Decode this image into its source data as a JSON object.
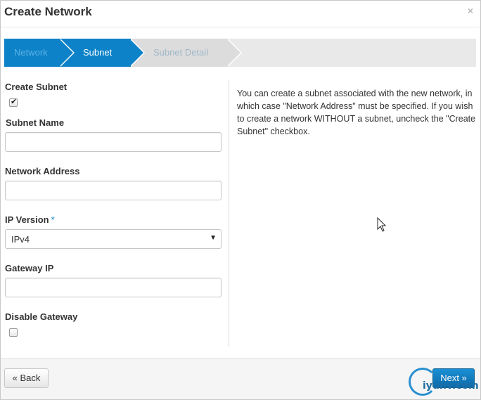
{
  "dialog": {
    "title": "Create Network",
    "close_icon": "close-icon",
    "close_glyph": "×"
  },
  "wizard": {
    "steps": [
      {
        "label": "Network",
        "state": "completed"
      },
      {
        "label": "Subnet",
        "state": "active"
      },
      {
        "label": "Subnet Detail",
        "state": "pending"
      }
    ],
    "active_color": "#0d82c8"
  },
  "form": {
    "create_subnet": {
      "label": "Create Subnet",
      "checked": true
    },
    "subnet_name": {
      "label": "Subnet Name",
      "value": ""
    },
    "network_address": {
      "label": "Network Address",
      "value": ""
    },
    "ip_version": {
      "label": "IP Version",
      "required_marker": "*",
      "selected": "IPv4"
    },
    "gateway_ip": {
      "label": "Gateway IP",
      "value": ""
    },
    "disable_gateway": {
      "label": "Disable Gateway",
      "checked": false
    }
  },
  "help": {
    "text": "You can create a subnet associated with the new network, in which case \"Network Address\" must be specified. If you wish to create a network WITHOUT a subnet, uncheck the \"Create Subnet\" checkbox."
  },
  "footer": {
    "back_label": "« Back",
    "next_label": "Next »"
  },
  "watermark": {
    "text": "iyunv.com"
  }
}
